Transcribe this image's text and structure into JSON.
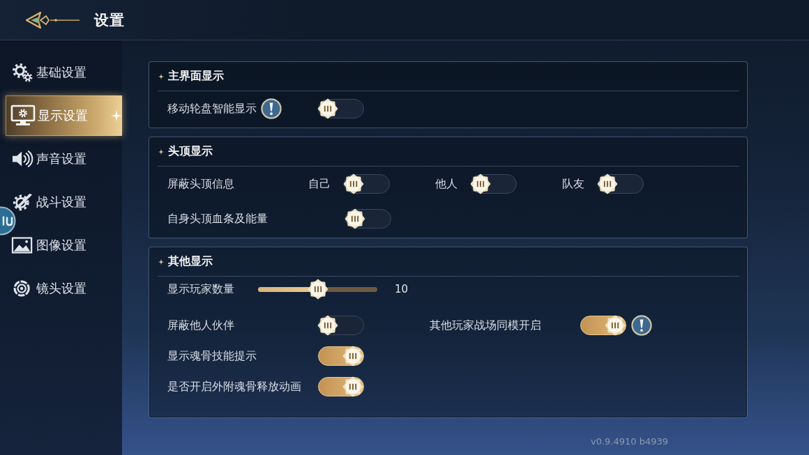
{
  "header": {
    "title": "设置"
  },
  "sidebar": {
    "items": [
      {
        "label": "基础设置",
        "selected": false
      },
      {
        "label": "显示设置",
        "selected": true
      },
      {
        "label": "声音设置",
        "selected": false
      },
      {
        "label": "战斗设置",
        "selected": false
      },
      {
        "label": "图像设置",
        "selected": false
      },
      {
        "label": "镜头设置",
        "selected": false
      }
    ]
  },
  "sections": [
    {
      "title": "主界面显示",
      "rows": [
        {
          "kind": "toggle",
          "label": "移动轮盘智能显示",
          "info": true,
          "on": false
        }
      ]
    },
    {
      "title": "头顶显示",
      "rows": [
        {
          "kind": "options",
          "label": "屏蔽头顶信息",
          "options": [
            {
              "label": "自己",
              "on": false
            },
            {
              "label": "他人",
              "on": false
            },
            {
              "label": "队友",
              "on": false
            }
          ]
        },
        {
          "kind": "toggle",
          "label": "自身头顶血条及能量",
          "info": false,
          "on": false
        }
      ]
    },
    {
      "title": "其他显示",
      "rows": [
        {
          "kind": "slider",
          "label": "显示玩家数量",
          "level": 0.5,
          "reading": "10"
        },
        {
          "kind": "pair",
          "items": [
            {
              "label": "屏蔽他人伙伴",
              "info": false,
              "on": false
            },
            {
              "label": "其他玩家战场同模开启",
              "info": true,
              "on": true
            }
          ]
        },
        {
          "kind": "toggle",
          "label": "显示魂骨技能提示",
          "info": false,
          "on": true
        },
        {
          "kind": "toggle",
          "label": "是否开启外附魂骨释放动画",
          "info": false,
          "on": true
        }
      ]
    }
  ],
  "version": "v0.9.4910 b4939"
}
